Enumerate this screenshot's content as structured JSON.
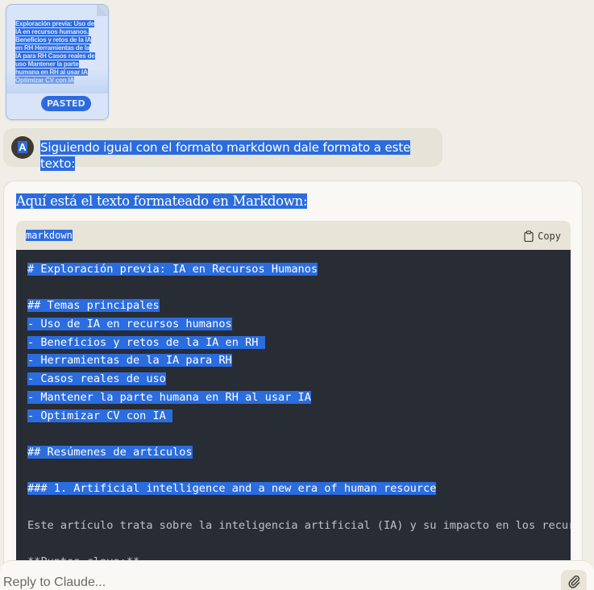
{
  "pasted": {
    "lines": [
      "Exploración previa: Uso de",
      "IA en recursos humanos.",
      "Beneficios y retos de la IA",
      "en RH Herramientas de la",
      "IA para RH Casos reales de",
      "uso Mantener la parte",
      "humana en RH al usar IA",
      "Optimizar CV con IA"
    ],
    "badge": "PASTED"
  },
  "user_message": {
    "avatar_initial": "A",
    "text": "Siguiendo igual con el formato markdown dale formato a este texto:"
  },
  "assistant": {
    "intro": "Aquí está el texto formateado en Markdown:",
    "code_block": {
      "language": "markdown",
      "copy_label": "Copy",
      "lines": [
        {
          "text": "# Exploración previa: IA en Recursos Humanos",
          "selected": true
        },
        {
          "text": "",
          "selected": false
        },
        {
          "text": "## Temas principales",
          "selected": true
        },
        {
          "text": "- Uso de IA en recursos humanos",
          "selected": true
        },
        {
          "text": "- Beneficios y retos de la IA en RH ",
          "selected": true
        },
        {
          "text": "- Herramientas de la IA para RH",
          "selected": true
        },
        {
          "text": "- Casos reales de uso",
          "selected": true
        },
        {
          "text": "- Mantener la parte humana en RH al usar IA",
          "selected": true
        },
        {
          "text": "- Optimizar CV con IA ",
          "selected": true
        },
        {
          "text": "",
          "selected": false
        },
        {
          "text": "## Resúmenes de artículos",
          "selected": true
        },
        {
          "text": "",
          "selected": false
        },
        {
          "text": "### 1. Artificial intelligence and a new era of human resource",
          "selected": true
        },
        {
          "text": "",
          "selected": false
        },
        {
          "text": "Este artículo trata sobre la inteligencia artificial (IA) y su impacto en los recursos humanos",
          "selected": false
        },
        {
          "text": "",
          "selected": false
        },
        {
          "text": "**Puntos clave:**",
          "selected": false
        }
      ]
    }
  },
  "reply": {
    "placeholder": "Reply to Claude..."
  },
  "colors": {
    "selection": "#2b6cde",
    "page_background": "#f0eee6",
    "code_background": "#282c34"
  }
}
